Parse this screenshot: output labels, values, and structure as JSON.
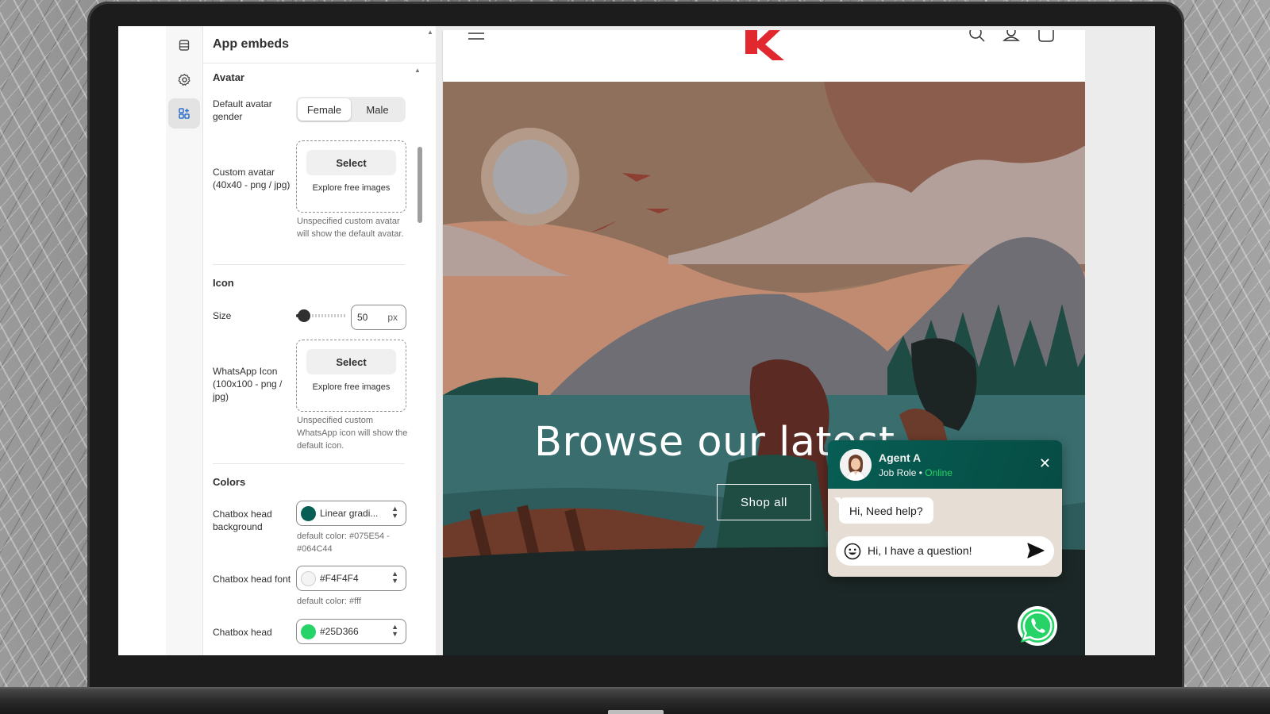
{
  "panel": {
    "title": "App embeds",
    "avatar": {
      "heading": "Avatar",
      "gender_label": "Default avatar gender",
      "gender_options": [
        "Female",
        "Male"
      ],
      "gender_selected": "Female",
      "custom_label": "Custom avatar (40x40 - png / jpg)",
      "select_label": "Select",
      "explore_label": "Explore free images",
      "help": "Unspecified custom avatar will show the default avatar."
    },
    "icon": {
      "heading": "Icon",
      "size_label": "Size",
      "size_value": "50",
      "size_unit": "px",
      "size_level": 0.08,
      "wa_label": "WhatsApp Icon (100x100 - png / jpg)",
      "select_label": "Select",
      "explore_label": "Explore free images",
      "help": "Unspecified custom WhatsApp icon will show the default icon."
    },
    "colors": {
      "heading": "Colors",
      "head_bg_label": "Chatbox head background",
      "head_bg_value": "Linear gradi...",
      "head_bg_swatch": "#075E54",
      "head_bg_help": "default color: #075E54 - #064C44",
      "head_font_label": "Chatbox head font",
      "head_font_value": "#F4F4F4",
      "head_font_swatch": "#F4F4F4",
      "head_font_help": "default color: #fff",
      "head_third_label": "Chatbox head",
      "head_third_value": "#25D366",
      "head_third_swatch": "#25D366"
    }
  },
  "rail": {
    "icons": [
      "database-icon",
      "gear-icon",
      "apps-icon"
    ],
    "active": "apps-icon"
  },
  "store": {
    "hero_title": "Browse our latest",
    "shop_button": "Shop all",
    "logo_color": "#E0282E"
  },
  "chat": {
    "agent_name": "Agent A",
    "agent_role": "Job Role",
    "separator": " • ",
    "status": "Online",
    "greeting": "Hi, Need help?",
    "input_text": "Hi, I have a question!"
  }
}
